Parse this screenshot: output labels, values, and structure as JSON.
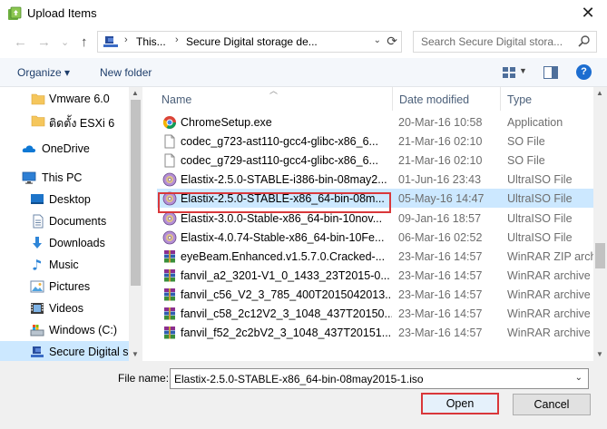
{
  "window": {
    "title": "Upload Items",
    "close_glyph": "✕"
  },
  "nav": {
    "back_glyph": "←",
    "forward_glyph": "→",
    "history_glyph": "⌄",
    "up_glyph": "↑"
  },
  "address": {
    "sep_glyph": "›",
    "crumbs": [
      "This...",
      "Secure Digital storage de..."
    ],
    "dropdown_glyph": "⌄",
    "refresh_glyph": "⟳"
  },
  "search": {
    "placeholder": "Search Secure Digital stora..."
  },
  "toolbar": {
    "organize_label": "Organize ▾",
    "new_folder_label": "New folder",
    "view_dropdown_glyph": "▼",
    "help_label": "?"
  },
  "sidebar": {
    "items": [
      {
        "label": "Vmware 6.0",
        "icon": "folder-icon"
      },
      {
        "label": "ติดตั้ง ESXi 6",
        "icon": "folder-icon"
      },
      {
        "label": "OneDrive",
        "icon": "onedrive-icon"
      },
      {
        "label": "This PC",
        "icon": "computer-icon"
      },
      {
        "label": "Desktop",
        "icon": "desktop-icon"
      },
      {
        "label": "Documents",
        "icon": "documents-icon"
      },
      {
        "label": "Downloads",
        "icon": "downloads-icon"
      },
      {
        "label": "Music",
        "icon": "music-icon"
      },
      {
        "label": "Pictures",
        "icon": "pictures-icon"
      },
      {
        "label": "Videos",
        "icon": "videos-icon"
      },
      {
        "label": "Windows (C:)",
        "icon": "drive-icon"
      },
      {
        "label": "Secure Digital s",
        "icon": "sd-card-icon"
      }
    ],
    "scroll_up_glyph": "▲",
    "scroll_down_glyph": "▼"
  },
  "columns": {
    "sort_glyph": "︿",
    "name": "Name",
    "date": "Date modified",
    "type": "Type"
  },
  "files": [
    {
      "name": "ChromeSetup.exe",
      "date": "20-Mar-16 10:58",
      "type": "Application",
      "icon": "chrome-icon"
    },
    {
      "name": "codec_g723-ast110-gcc4-glibc-x86_6...",
      "date": "21-Mar-16 02:10",
      "type": "SO File",
      "icon": "file-icon"
    },
    {
      "name": "codec_g729-ast110-gcc4-glibc-x86_6...",
      "date": "21-Mar-16 02:10",
      "type": "SO File",
      "icon": "file-icon"
    },
    {
      "name": "Elastix-2.5.0-STABLE-i386-bin-08may2...",
      "date": "01-Jun-16 23:43",
      "type": "UltraISO File",
      "icon": "disc-icon"
    },
    {
      "name": "Elastix-2.5.0-STABLE-x86_64-bin-08m...",
      "date": "05-May-16 14:47",
      "type": "UltraISO File",
      "icon": "disc-icon"
    },
    {
      "name": "Elastix-3.0.0-Stable-x86_64-bin-10nov...",
      "date": "09-Jan-16 18:57",
      "type": "UltraISO File",
      "icon": "disc-icon"
    },
    {
      "name": "Elastix-4.0.74-Stable-x86_64-bin-10Fe...",
      "date": "06-Mar-16 02:52",
      "type": "UltraISO File",
      "icon": "disc-icon"
    },
    {
      "name": "eyeBeam.Enhanced.v1.5.7.0.Cracked-...",
      "date": "23-Mar-16 14:57",
      "type": "WinRAR ZIP archi",
      "icon": "winrar-icon"
    },
    {
      "name": "fanvil_a2_3201-V1_0_1433_23T2015-0...",
      "date": "23-Mar-16 14:57",
      "type": "WinRAR archive",
      "icon": "winrar-icon"
    },
    {
      "name": "fanvil_c56_V2_3_785_400T2015042013...",
      "date": "23-Mar-16 14:57",
      "type": "WinRAR archive",
      "icon": "winrar-icon"
    },
    {
      "name": "fanvil_c58_2c12V2_3_1048_437T20150...",
      "date": "23-Mar-16 14:57",
      "type": "WinRAR archive",
      "icon": "winrar-icon"
    },
    {
      "name": "fanvil_f52_2c2bV2_3_1048_437T20151...",
      "date": "23-Mar-16 14:57",
      "type": "WinRAR archive",
      "icon": "winrar-icon"
    }
  ],
  "selected_index": 4,
  "footer": {
    "file_name_label": "File name:",
    "file_name_value": "Elastix-2.5.0-STABLE-x86_64-bin-08may2015-1.iso",
    "dropdown_glyph": "⌄",
    "open_label": "Open",
    "cancel_label": "Cancel"
  },
  "colors": {
    "selection": "#cce8ff",
    "highlight_red": "#d9373a",
    "link_blue": "#1e3e6b"
  }
}
